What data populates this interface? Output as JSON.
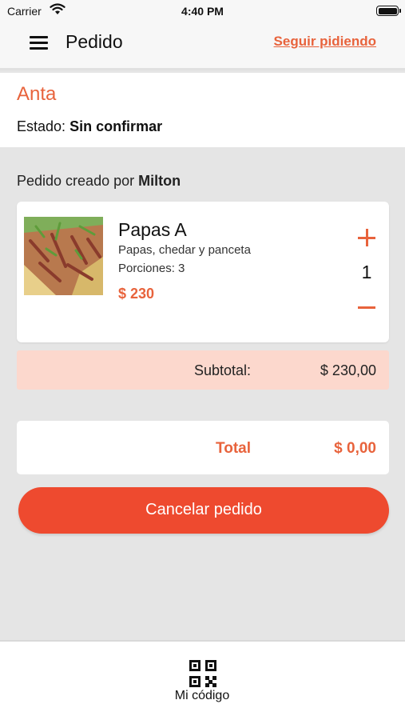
{
  "status_bar": {
    "carrier": "Carrier",
    "time": "4:40 PM"
  },
  "nav": {
    "title": "Pedido",
    "continue_label": "Seguir pidiendo"
  },
  "order": {
    "restaurant": "Anta",
    "status_label": "Estado:",
    "status_value": "Sin confirmar",
    "created_by_label": "Pedido creado por",
    "created_by_name": "Milton"
  },
  "item": {
    "name": "Papas A",
    "description": "Papas, chedar y panceta",
    "portions": "Porciones: 3",
    "price": "$ 230",
    "quantity": "1"
  },
  "subtotal": {
    "label": "Subtotal:",
    "value": "$ 230,00"
  },
  "total": {
    "label": "Total",
    "value": "$ 0,00"
  },
  "cancel_button": "Cancelar pedido",
  "tab": {
    "label": "Mi código"
  },
  "colors": {
    "accent": "#e8633c",
    "button": "#ee4a2f",
    "subtotal_bg": "#fcd8cd"
  }
}
